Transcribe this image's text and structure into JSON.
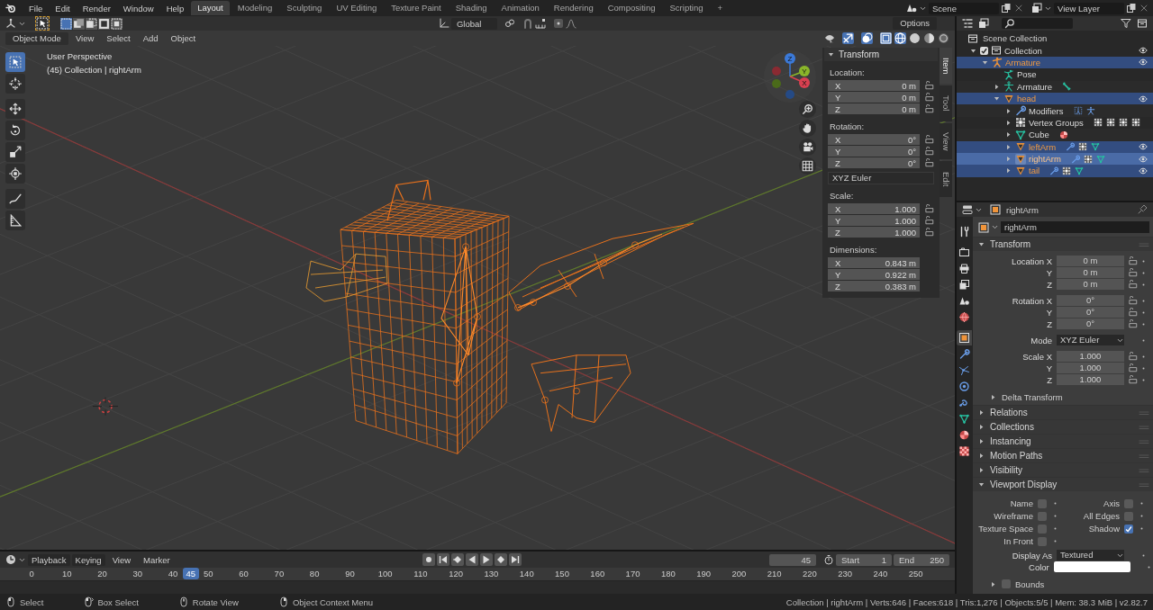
{
  "top_bar": {
    "menus": [
      "File",
      "Edit",
      "Render",
      "Window",
      "Help"
    ],
    "workspaces": [
      {
        "label": "Layout",
        "selected": true
      },
      {
        "label": "Modeling",
        "selected": false
      },
      {
        "label": "Sculpting",
        "selected": false
      },
      {
        "label": "UV Editing",
        "selected": false
      },
      {
        "label": "Texture Paint",
        "selected": false
      },
      {
        "label": "Shading",
        "selected": false
      },
      {
        "label": "Animation",
        "selected": false
      },
      {
        "label": "Rendering",
        "selected": false
      },
      {
        "label": "Compositing",
        "selected": false
      },
      {
        "label": "Scripting",
        "selected": false
      }
    ],
    "add_workspace": "+",
    "scene": "Scene",
    "view_layer": "View Layer"
  },
  "tool_settings": {
    "select_modes": [
      {
        "selected": true
      },
      {
        "selected": false
      },
      {
        "selected": false
      },
      {
        "selected": false
      },
      {
        "selected": false
      }
    ],
    "orientation": "Global",
    "options": "Options"
  },
  "viewport_header": {
    "mode": "Object Mode",
    "menus": [
      "View",
      "Select",
      "Add",
      "Object"
    ],
    "shading_modes": [
      {
        "selected": true
      },
      {
        "selected": false
      },
      {
        "selected": false
      },
      {
        "selected": false
      }
    ]
  },
  "viewport": {
    "perspective": "User Perspective",
    "context": "(45) Collection | rightArm",
    "tools": [
      {
        "kind": "select-box",
        "selected": true
      },
      {
        "kind": "cursor",
        "selected": false
      },
      {
        "kind": "move",
        "selected": false
      },
      {
        "kind": "rotate",
        "selected": false
      },
      {
        "kind": "scale",
        "selected": false
      },
      {
        "kind": "transform",
        "selected": false
      },
      {
        "kind": "annotate",
        "selected": false
      },
      {
        "kind": "measure",
        "selected": false
      }
    ],
    "gizmo": {
      "x": "X",
      "y": "Y",
      "z": "Z"
    }
  },
  "sidebar": {
    "tabs": [
      {
        "label": "Item",
        "selected": true
      },
      {
        "label": "Tool",
        "selected": false
      },
      {
        "label": "View",
        "selected": false
      },
      {
        "label": "Edit",
        "selected": false
      }
    ],
    "panel": "Transform",
    "groups": [
      {
        "kind": "vector",
        "label": "Location:",
        "locks": true,
        "fields": [
          {
            "axis": "X",
            "value": "0 m"
          },
          {
            "axis": "Y",
            "value": "0 m"
          },
          {
            "axis": "Z",
            "value": "0 m"
          }
        ]
      },
      {
        "kind": "vector",
        "label": "Rotation:",
        "locks": true,
        "fields": [
          {
            "axis": "X",
            "value": "0°"
          },
          {
            "axis": "Y",
            "value": "0°"
          },
          {
            "axis": "Z",
            "value": "0°"
          }
        ]
      },
      {
        "kind": "dropdown",
        "value": "XYZ Euler"
      },
      {
        "kind": "vector",
        "label": "Scale:",
        "locks": true,
        "fields": [
          {
            "axis": "X",
            "value": "1.000"
          },
          {
            "axis": "Y",
            "value": "1.000"
          },
          {
            "axis": "Z",
            "value": "1.000"
          }
        ]
      },
      {
        "kind": "vector",
        "label": "Dimensions:",
        "locks": false,
        "fields": [
          {
            "axis": "X",
            "value": "0.843 m"
          },
          {
            "axis": "Y",
            "value": "0.922 m"
          },
          {
            "axis": "Z",
            "value": "0.383 m"
          }
        ]
      }
    ]
  },
  "outliner": {
    "root": "Scene Collection",
    "items": [
      {
        "label": "Collection",
        "kind": "collection",
        "checked": true,
        "expanded": true,
        "selected": false,
        "active": false,
        "eye": true,
        "children": [
          {
            "label": "Armature",
            "kind": "armature",
            "expanded": true,
            "selected": true,
            "active": false,
            "eye": true,
            "children": [
              {
                "label": "Pose",
                "kind": "pose",
                "selected": false,
                "active": false,
                "eye": false
              },
              {
                "label": "Armature",
                "kind": "armature-data",
                "expanded": false,
                "selected": false,
                "active": false,
                "eye": false,
                "extras": [
                  {
                    "kind": "bone"
                  }
                ]
              },
              {
                "label": "head",
                "kind": "mesh",
                "expanded": true,
                "selected": true,
                "active": false,
                "eye": true,
                "children": [
                  {
                    "label": "Modifiers",
                    "kind": "wrench",
                    "expanded": false,
                    "selected": false,
                    "active": false,
                    "eye": false,
                    "extras": [
                      {
                        "kind": "dotted-figure"
                      },
                      {
                        "kind": "figure"
                      }
                    ]
                  },
                  {
                    "label": "Vertex Groups",
                    "kind": "vertex-group",
                    "expanded": false,
                    "selected": false,
                    "active": false,
                    "eye": false,
                    "extras": [
                      {
                        "kind": "vertex-group"
                      },
                      {
                        "kind": "vertex-group"
                      },
                      {
                        "kind": "vertex-group"
                      },
                      {
                        "kind": "vertex-group"
                      }
                    ]
                  },
                  {
                    "label": "Cube",
                    "kind": "mesh-data",
                    "expanded": false,
                    "selected": false,
                    "active": false,
                    "eye": false,
                    "extras": [
                      {
                        "kind": "material"
                      }
                    ]
                  },
                  {
                    "label": "leftArm",
                    "kind": "mesh",
                    "expanded": false,
                    "selected": true,
                    "active": false,
                    "eye": true,
                    "extras": [
                      {
                        "kind": "wrench"
                      },
                      {
                        "kind": "vertex-group"
                      },
                      {
                        "kind": "mesh-data"
                      }
                    ]
                  },
                  {
                    "label": "rightArm",
                    "kind": "mesh",
                    "expanded": false,
                    "selected": true,
                    "active": true,
                    "eye": true,
                    "extras": [
                      {
                        "kind": "wrench"
                      },
                      {
                        "kind": "vertex-group"
                      },
                      {
                        "kind": "mesh-data"
                      }
                    ]
                  },
                  {
                    "label": "tail",
                    "kind": "mesh",
                    "expanded": false,
                    "selected": true,
                    "active": false,
                    "eye": true,
                    "extras": [
                      {
                        "kind": "wrench"
                      },
                      {
                        "kind": "vertex-group"
                      },
                      {
                        "kind": "mesh-data"
                      }
                    ]
                  }
                ]
              }
            ]
          }
        ]
      }
    ]
  },
  "properties": {
    "tabs": [
      {
        "kind": "tool",
        "selected": false
      },
      {
        "kind": "render",
        "selected": false
      },
      {
        "kind": "output",
        "selected": false
      },
      {
        "kind": "view-layer",
        "selected": false
      },
      {
        "kind": "scene",
        "selected": false
      },
      {
        "kind": "world",
        "selected": false
      },
      {
        "kind": "object",
        "selected": true
      },
      {
        "kind": "wrench",
        "selected": false
      },
      {
        "kind": "particles",
        "selected": false
      },
      {
        "kind": "physics",
        "selected": false
      },
      {
        "kind": "constraints",
        "selected": false
      },
      {
        "kind": "mesh-data",
        "selected": false
      },
      {
        "kind": "material",
        "selected": false
      },
      {
        "kind": "texture",
        "selected": false
      }
    ],
    "context": "rightArm",
    "object_name": "rightArm",
    "panels": [
      {
        "title": "Transform",
        "expanded": true,
        "groups": [
          {
            "rows": [
              {
                "kind": "field",
                "label": "Location X",
                "value": "0 m",
                "lock": true
              },
              {
                "kind": "field",
                "label": "Y",
                "value": "0 m",
                "lock": true
              },
              {
                "kind": "field",
                "label": "Z",
                "value": "0 m",
                "lock": true
              }
            ]
          },
          {
            "rows": [
              {
                "kind": "field",
                "label": "Rotation X",
                "value": "0°",
                "lock": true
              },
              {
                "kind": "field",
                "label": "Y",
                "value": "0°",
                "lock": true
              },
              {
                "kind": "field",
                "label": "Z",
                "value": "0°",
                "lock": true
              }
            ]
          },
          {
            "rows": [
              {
                "kind": "dropdown",
                "label": "Mode",
                "value": "XYZ Euler"
              }
            ]
          },
          {
            "rows": [
              {
                "kind": "field",
                "label": "Scale X",
                "value": "1.000",
                "lock": true
              },
              {
                "kind": "field",
                "label": "Y",
                "value": "1.000",
                "lock": true
              },
              {
                "kind": "field",
                "label": "Z",
                "value": "1.000",
                "lock": true
              }
            ]
          }
        ],
        "subpanels": [
          {
            "title": "Delta Transform",
            "expanded": false
          }
        ]
      },
      {
        "title": "Relations",
        "expanded": false
      },
      {
        "title": "Collections",
        "expanded": false
      },
      {
        "title": "Instancing",
        "expanded": false
      },
      {
        "title": "Motion Paths",
        "expanded": false
      },
      {
        "title": "Visibility",
        "expanded": false
      },
      {
        "title": "Viewport Display",
        "expanded": true,
        "checks": [
          {
            "label": "Name",
            "checked": false
          },
          {
            "label": "Axis",
            "checked": false
          },
          {
            "label": "Wireframe",
            "checked": false
          },
          {
            "label": "All Edges",
            "checked": false
          },
          {
            "label": "Texture Space",
            "checked": false
          },
          {
            "label": "Shadow",
            "checked": true
          },
          {
            "label": "In Front",
            "checked": false
          }
        ],
        "groups": [
          {
            "rows": [
              {
                "kind": "dropdown",
                "label": "Display As",
                "value": "Textured"
              },
              {
                "kind": "color",
                "label": "Color",
                "color": "#ffffff"
              }
            ]
          }
        ],
        "subpanels": [
          {
            "title": "Bounds",
            "expanded": false,
            "checked": false
          }
        ]
      }
    ]
  },
  "timeline": {
    "menus": [
      "Playback",
      "Keying",
      "View",
      "Marker"
    ],
    "frame": "45",
    "start_label": "Start",
    "start": "1",
    "end_label": "End",
    "end": "250",
    "ticks": [
      "0",
      "10",
      "20",
      "30",
      "40",
      "50",
      "60",
      "70",
      "80",
      "90",
      "100",
      "110",
      "120",
      "130",
      "140",
      "150",
      "160",
      "170",
      "180",
      "190",
      "200",
      "210",
      "220",
      "230",
      "240",
      "250"
    ],
    "playhead": {
      "label": "45",
      "level": 0.18
    }
  },
  "status_bar": {
    "hints": [
      {
        "kind": "mouse-left",
        "label": "Select"
      },
      {
        "kind": "mouse-drag",
        "label": "Box Select"
      },
      {
        "kind": "mouse-middle",
        "label": "Rotate View"
      },
      {
        "kind": "mouse-right",
        "label": "Object Context Menu"
      }
    ],
    "stats": "Collection | rightArm | Verts:646 | Faces:618 | Tris:1,276 | Objects:5/5 | Mem: 38.3 MiB | v2.82.7"
  }
}
